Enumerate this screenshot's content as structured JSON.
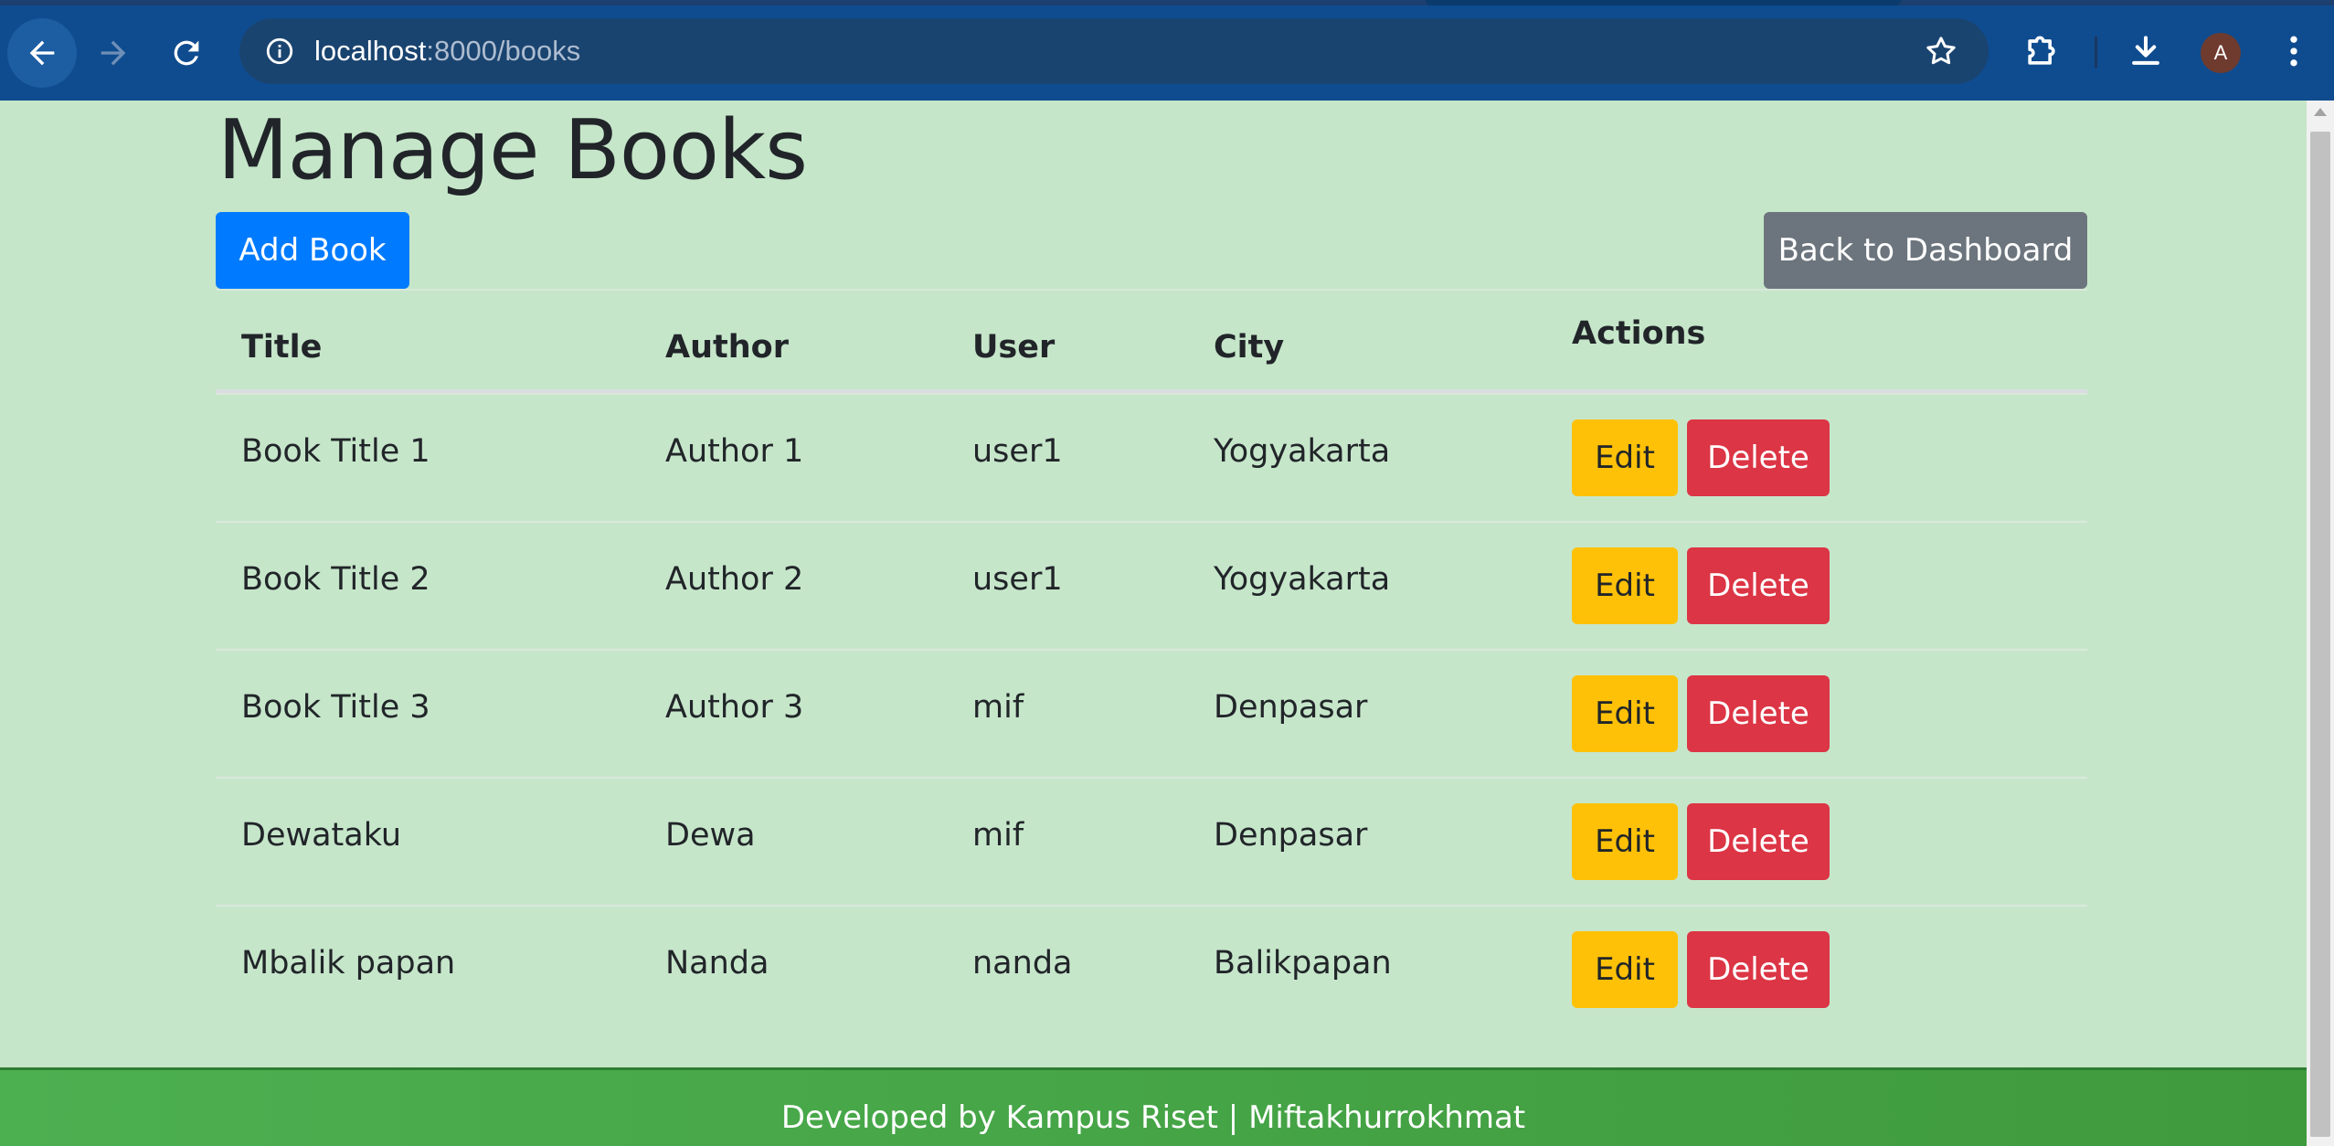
{
  "browser": {
    "url_host": "localhost",
    "url_rest": ":8000/books",
    "avatar_letter": "A",
    "icons": {
      "back": "arrow-left-icon",
      "forward": "arrow-right-icon",
      "reload": "reload-icon",
      "site_info": "info-icon",
      "bookmark": "star-icon",
      "extensions": "puzzle-icon",
      "downloads": "download-icon",
      "menu": "kebab-menu-icon"
    }
  },
  "page": {
    "title": "Manage Books",
    "add_button": "Add Book",
    "back_button": "Back to Dashboard"
  },
  "table": {
    "headers": [
      "Title",
      "Author",
      "User",
      "City",
      "Actions"
    ],
    "rows": [
      {
        "title": "Book Title 1",
        "author": "Author 1",
        "user": "user1",
        "city": "Yogyakarta"
      },
      {
        "title": "Book Title 2",
        "author": "Author 2",
        "user": "user1",
        "city": "Yogyakarta"
      },
      {
        "title": "Book Title 3",
        "author": "Author 3",
        "user": "mif",
        "city": "Denpasar"
      },
      {
        "title": "Dewataku",
        "author": "Dewa",
        "user": "mif",
        "city": "Denpasar"
      },
      {
        "title": "Mbalik papan",
        "author": "Nanda",
        "user": "nanda",
        "city": "Balikpapan"
      }
    ],
    "edit_label": "Edit",
    "delete_label": "Delete"
  },
  "footer": {
    "text": "Developed by Kampus Riset | Miftakhurrokhmat"
  },
  "colors": {
    "page_bg": "#c6e6ca",
    "primary": "#007bff",
    "secondary": "#6c757d",
    "warning": "#ffc107",
    "danger": "#dc3545",
    "footer": "#4caf50",
    "chrome": "#0f4c8f"
  }
}
